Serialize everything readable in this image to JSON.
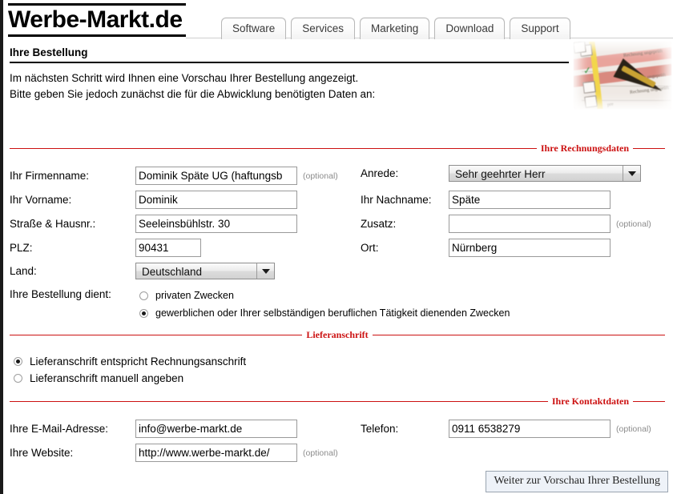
{
  "site": {
    "logo": "Werbe-Markt.de"
  },
  "nav": {
    "tabs": [
      {
        "label": "Software"
      },
      {
        "label": "Services"
      },
      {
        "label": "Marketing"
      },
      {
        "label": "Download"
      },
      {
        "label": "Support"
      }
    ]
  },
  "page": {
    "title": "Ihre Bestellung",
    "intro_line1": "Im nächsten Schritt wird Ihnen eine Vorschau Ihrer Bestellung angezeigt.",
    "intro_line2": "Bitte geben Sie jedoch zunächst die für die Abwicklung benötigten Daten an:"
  },
  "hero_image": {
    "alt": "invoice-form-with-pen-photo",
    "checkbox_mark": "✓",
    "blur_texts": [
      "Rechnung ungeprüft",
      "Rechnung ungeprüft",
      "Rechnung ungeprüft",
      "pre"
    ]
  },
  "sections": {
    "billing": {
      "legend": "Ihre Rechnungsdaten"
    },
    "shipping": {
      "legend": "Lieferanschrift"
    },
    "contact": {
      "legend": "Ihre Kontaktdaten"
    }
  },
  "optional_label": "(optional)",
  "billing": {
    "company_label": "Ihr Firmenname:",
    "company_value": "Dominik Späte UG (haftungsb",
    "salutation_label": "Anrede:",
    "salutation_value": "Sehr geehrter Herr",
    "firstname_label": "Ihr Vorname:",
    "firstname_value": "Dominik",
    "lastname_label": "Ihr Nachname:",
    "lastname_value": "Späte",
    "street_label": "Straße & Hausnr.:",
    "street_value": "Seeleinsbühlstr. 30",
    "extra_label": "Zusatz:",
    "extra_value": "",
    "zip_label": "PLZ:",
    "zip_value": "90431",
    "city_label": "Ort:",
    "city_value": "Nürnberg",
    "country_label": "Land:",
    "country_value": "Deutschland",
    "purpose_label": "Ihre Bestellung dient:",
    "purpose_option_private": "privaten Zwecken",
    "purpose_option_business": "gewerblichen oder Ihrer selbständigen beruflichen Tätigkeit dienenden Zwecken",
    "purpose_selected": "business"
  },
  "shipping": {
    "option_same": "Lieferanschrift entspricht Rechnungsanschrift",
    "option_manual": "Lieferanschrift manuell angeben",
    "selected": "same"
  },
  "contact": {
    "email_label": "Ihre E-Mail-Adresse:",
    "email_value": "info@werbe-markt.de",
    "phone_label": "Telefon:",
    "phone_value": "0911 6538279",
    "website_label": "Ihre Website:",
    "website_value": "http://www.werbe-markt.de/"
  },
  "submit": {
    "label": "Weiter zur Vorschau Ihrer Bestellung"
  },
  "colors": {
    "legend_red": "#cc1111",
    "border_gray": "#9a9a9a",
    "optional_gray": "#8c8c8c"
  }
}
